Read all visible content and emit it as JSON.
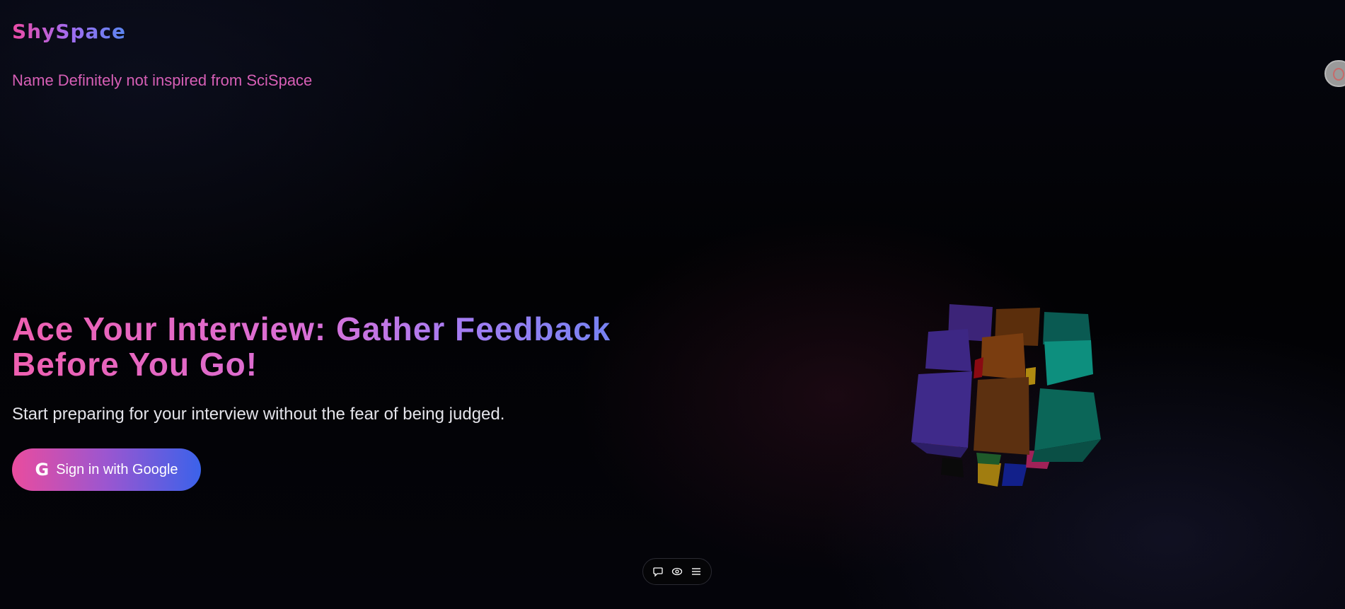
{
  "brand": {
    "name": "ShySpace",
    "tagline": "Name Definitely not inspired from SciSpace"
  },
  "hero": {
    "headline": "Ace Your Interview: Gather Feedback Before You Go!",
    "subtitle": "Start preparing for your interview without the fear of being judged.",
    "cta_label": "Sign in with Google",
    "cta_icon": "google-g-icon"
  },
  "toolbar": {
    "items": [
      {
        "icon": "chat-bubble-icon"
      },
      {
        "icon": "eye-icon"
      },
      {
        "icon": "menu-icon"
      }
    ]
  },
  "colors": {
    "background": "#030308",
    "accent_pink": "#ec4ba4",
    "accent_purple": "#a36cf0",
    "accent_blue": "#3b62ea",
    "tagline": "#d75fb6"
  }
}
